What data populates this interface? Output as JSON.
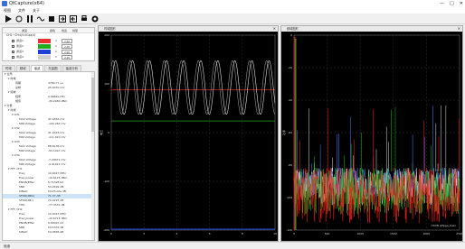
{
  "window": {
    "title": "QtCapture(x64)",
    "controls": [
      "—",
      "□",
      "✕"
    ]
  },
  "menu": [
    "视图",
    "文件",
    "关于"
  ],
  "toolbar": [
    {
      "name": "play-icon",
      "glyph": "play"
    },
    {
      "name": "record-icon",
      "glyph": "record"
    },
    {
      "name": "pause-icon",
      "glyph": "pause"
    },
    {
      "name": "wave-icon",
      "glyph": "wave"
    },
    {
      "name": "stop-icon",
      "glyph": "stop"
    },
    {
      "name": "export-icon",
      "glyph": "export"
    },
    {
      "name": "import-icon",
      "glyph": "import"
    },
    {
      "name": "print-icon",
      "glyph": "print"
    },
    {
      "name": "snapshot-icon",
      "glyph": "snap"
    }
  ],
  "series_table": {
    "headers": [
      "通道",
      "颜色",
      "线宽",
      "线型"
    ],
    "group_label": "CH1~CH4(5.0Gsa/s)",
    "rows": [
      {
        "name": "通道1",
        "color": "#e83232",
        "width": "1",
        "offset": "2.00"
      },
      {
        "name": "通道2",
        "color": "#22aa22",
        "width": "1",
        "offset": "2.00"
      },
      {
        "name": "通道3",
        "color": "#1e3fd8",
        "width": "1",
        "offset": "2.00"
      },
      {
        "name": "通道4",
        "color": "#cfcfcf",
        "width": "1",
        "offset": "2.00"
      }
    ]
  },
  "tabs": [
    "时域",
    "频域",
    "谐波",
    "矢量图",
    "谐波分析"
  ],
  "active_tab": 2,
  "tree": [
    {
      "k": "▾ 全局",
      "v": "",
      "indent": 0
    },
    {
      "k": "▾ 时域",
      "v": "",
      "indent": 1
    },
    {
      "k": "周期",
      "v": "3784.77 us",
      "indent": 3
    },
    {
      "k": "采样",
      "v": "25.0070 mV",
      "indent": 3
    },
    {
      "k": "▾ 频域",
      "v": "",
      "indent": 1
    },
    {
      "k": "频率",
      "v": "2.6682e kHz",
      "indent": 3
    },
    {
      "k": "幅值",
      "v": "-30.2480 dBm",
      "indent": 3
    },
    {
      "k": "▾ 分量",
      "v": "",
      "indent": 0
    },
    {
      "k": "▾ 时域",
      "v": "",
      "indent": 1
    },
    {
      "k": "▾ CH1",
      "v": "",
      "indent": 2
    },
    {
      "k": "MAX Voltage",
      "v": "92.0556 mV",
      "indent": 4
    },
    {
      "k": "MIN Voltage",
      "v": "-193.283 mV",
      "indent": 4
    },
    {
      "k": "▾ CH2",
      "v": "",
      "indent": 2
    },
    {
      "k": "MAX Voltage",
      "v": "91.0315 mV",
      "indent": 4
    },
    {
      "k": "MIN Voltage",
      "v": "-111.020 mV",
      "indent": 4
    },
    {
      "k": "▾ CH3",
      "v": "",
      "indent": 2
    },
    {
      "k": "MAX Voltage",
      "v": "88.6136 mV",
      "indent": 4
    },
    {
      "k": "MIN Voltage",
      "v": "-93.1497 mV",
      "indent": 4
    },
    {
      "k": "▾ CH4",
      "v": "",
      "indent": 2
    },
    {
      "k": "MAX Voltage",
      "v": "-7.29071 mV",
      "indent": 4
    },
    {
      "k": "MIN Voltage",
      "v": "-9.41021 mV",
      "indent": 4
    },
    {
      "k": "▾ FFT: CH1",
      "v": "",
      "indent": 1
    },
    {
      "k": "Freq",
      "v": "10.0027 MHz",
      "indent": 4
    },
    {
      "k": "Freq power",
      "v": "-10.6124 dBm",
      "indent": 4
    },
    {
      "k": "ENOB(Effec",
      "v": "6.71305 bit",
      "indent": 4
    },
    {
      "k": "SNR",
      "v": "54.2499 dB",
      "indent": 4
    },
    {
      "k": "SINAD",
      "v": "54.23 bits dB",
      "indent": 4
    },
    {
      "k": "SFDR(dBfs)",
      "v": "71.37 dB",
      "indent": 4,
      "sel": true
    },
    {
      "k": "SFDR(dBc)",
      "v": "70.4297 dB",
      "indent": 4
    },
    {
      "k": "THD",
      "v": "-77.3431 dB",
      "indent": 4
    },
    {
      "k": "▾ FFT: CH2",
      "v": "",
      "indent": 1
    },
    {
      "k": "Freq",
      "v": "10.0027 MHz",
      "indent": 4
    },
    {
      "k": "Freq power",
      "v": "-10.6711 dBm",
      "indent": 4
    },
    {
      "k": "ENOB(Effec",
      "v": "6.60097 bit",
      "indent": 4
    },
    {
      "k": "SNR",
      "v": "54.1301 dB",
      "indent": 4
    },
    {
      "k": "SINAD",
      "v": "54.0896 dB",
      "indent": 4
    }
  ],
  "status": "就绪",
  "time_plot": {
    "title": "时域图形",
    "ylabel": "电压",
    "y_ticks": [
      "200",
      "100",
      "0",
      "-100",
      "-200"
    ],
    "x_ticks": [
      "0",
      "2",
      "4",
      "6",
      "8",
      "10"
    ],
    "series": [
      {
        "color": "#e0e0e0",
        "amplitude": 0.55,
        "cycles": 9.6,
        "phase": 0.0
      },
      {
        "color": "#909090",
        "amplitude": 0.55,
        "cycles": 9.6,
        "phase": 0.9
      }
    ],
    "hlines": [
      {
        "color": "#ff3030",
        "level": 0.28
      },
      {
        "color": "#30c030",
        "level": 0.44
      }
    ],
    "bottom_line_color": "#1e3fd8"
  },
  "freq_plot": {
    "title": "频域图形",
    "ylabel": "功率",
    "y_ticks": [
      "0",
      "-20",
      "-40",
      "-60",
      "-80",
      "-100",
      "-120"
    ],
    "x_ticks": [
      "0",
      "500",
      "1000",
      "1500",
      "2000",
      "2500"
    ],
    "colors": [
      "#ff2020",
      "#20c020",
      "#e0e0e0",
      "#5080ff"
    ],
    "watermark": "CSDN @fpga_bear"
  }
}
